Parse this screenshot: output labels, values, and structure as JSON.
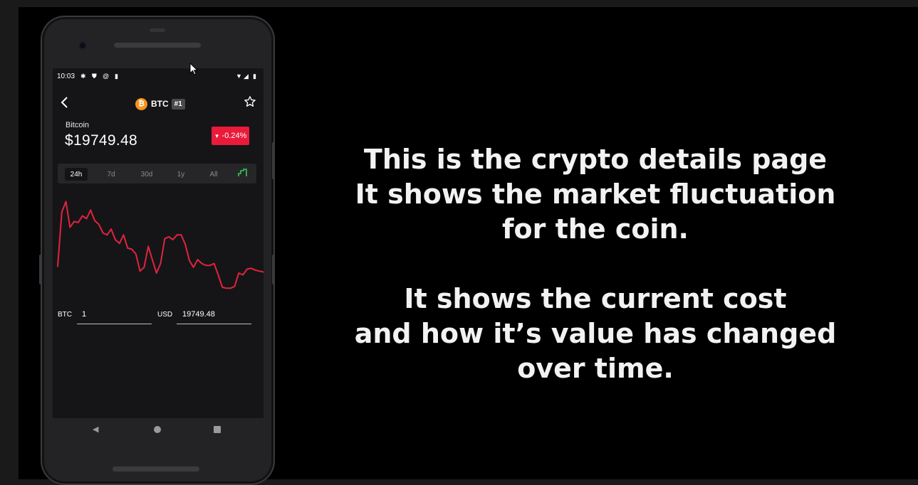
{
  "status_bar": {
    "time": "10:03",
    "left_icons": [
      "gear-icon",
      "shield-icon",
      "at-sign-icon",
      "sim-card-icon"
    ],
    "right_icons": [
      "wifi-icon",
      "cellular-signal-icon",
      "battery-icon"
    ]
  },
  "header": {
    "back_icon": "chevron-left-icon",
    "coin_logo_glyph": "₿",
    "coin_symbol": "BTC",
    "rank": "#1",
    "favorite_icon": "star-outline-icon"
  },
  "coin": {
    "name": "Bitcoin",
    "price": "$19749.48",
    "change": "-0.24%",
    "change_color": "#ea1b3a",
    "change_direction": "down"
  },
  "time_ranges": {
    "selected": "24h",
    "items": [
      "24h",
      "7d",
      "30d",
      "1y",
      "All"
    ],
    "chart_type_icon": "line-chart-toggle-icon"
  },
  "chart_data": {
    "type": "line",
    "title": "",
    "xlabel": "",
    "ylabel": "",
    "series": [
      {
        "color": "#e3233f",
        "values": [
          0.25,
          0.82,
          0.93,
          0.66,
          0.72,
          0.71,
          0.78,
          0.75,
          0.84,
          0.73,
          0.69,
          0.6,
          0.58,
          0.64,
          0.53,
          0.49,
          0.58,
          0.44,
          0.43,
          0.38,
          0.2,
          0.24,
          0.46,
          0.32,
          0.18,
          0.28,
          0.54,
          0.56,
          0.53,
          0.58,
          0.58,
          0.48,
          0.31,
          0.24,
          0.32,
          0.28,
          0.26,
          0.26,
          0.28,
          0.16,
          0.03,
          0.02,
          0.02,
          0.04,
          0.18,
          0.16,
          0.22,
          0.23,
          0.21,
          0.2,
          0.19
        ]
      }
    ]
  },
  "converter": {
    "crypto_label": "BTC",
    "crypto_value": "1",
    "fiat_label": "USD",
    "fiat_value": "19749.48"
  },
  "nav_bar": {
    "back_icon": "triangle-back-icon",
    "home_icon": "circle-home-icon",
    "recents_icon": "square-recents-icon"
  },
  "caption": {
    "line1": "This is the crypto details page",
    "line2": "It shows the market fluctuation",
    "line3": "for the coin.",
    "line4": "It shows the current cost",
    "line5": "and how it’s value has changed",
    "line6": "over time."
  }
}
